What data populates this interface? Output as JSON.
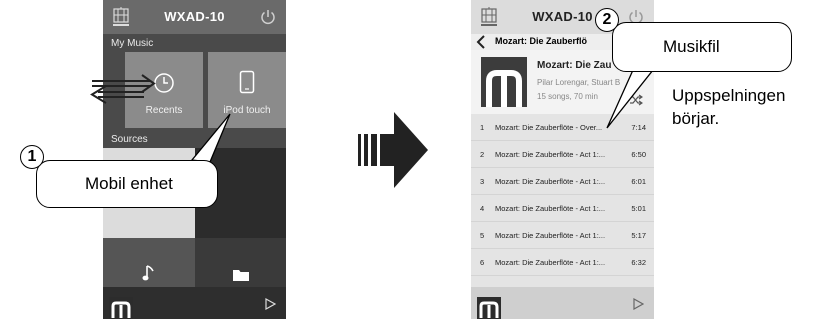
{
  "left_phone": {
    "device_name": "WXAD-10",
    "my_music_label": "My Music",
    "tiles": [
      {
        "label": "Recents",
        "icon": "clock-icon"
      },
      {
        "label": "iPod touch",
        "icon": "phone-icon"
      }
    ],
    "sources_label": "Sources",
    "source_icons": [
      "music-note-icon",
      "folder-icon"
    ]
  },
  "right_phone": {
    "device_name": "WXAD-10",
    "nav_title": "Mozart: Die Zauberflö",
    "album": {
      "title": "Mozart: Die Zau",
      "artist": "Pilar Lorengar, Stuart B",
      "count": "15 songs, 70 min"
    },
    "tracks": [
      {
        "num": "1",
        "title": "Mozart: Die Zauberflöte - Over...",
        "duration": "7:14"
      },
      {
        "num": "2",
        "title": "Mozart: Die Zauberflöte - Act 1:...",
        "duration": "6:50"
      },
      {
        "num": "3",
        "title": "Mozart: Die Zauberflöte - Act 1:...",
        "duration": "6:01"
      },
      {
        "num": "4",
        "title": "Mozart: Die Zauberflöte - Act 1:...",
        "duration": "5:01"
      },
      {
        "num": "5",
        "title": "Mozart: Die Zauberflöte - Act 1:...",
        "duration": "5:17"
      },
      {
        "num": "6",
        "title": "Mozart: Die Zauberflöte - Act 1:...",
        "duration": "6:32"
      }
    ]
  },
  "callouts": {
    "step1_number": "1",
    "step1_text": "Mobil enhet",
    "step2_number": "2",
    "step2_text": "Musikfil",
    "result_line1": "Uppspelningen",
    "result_line2": "börjar."
  }
}
